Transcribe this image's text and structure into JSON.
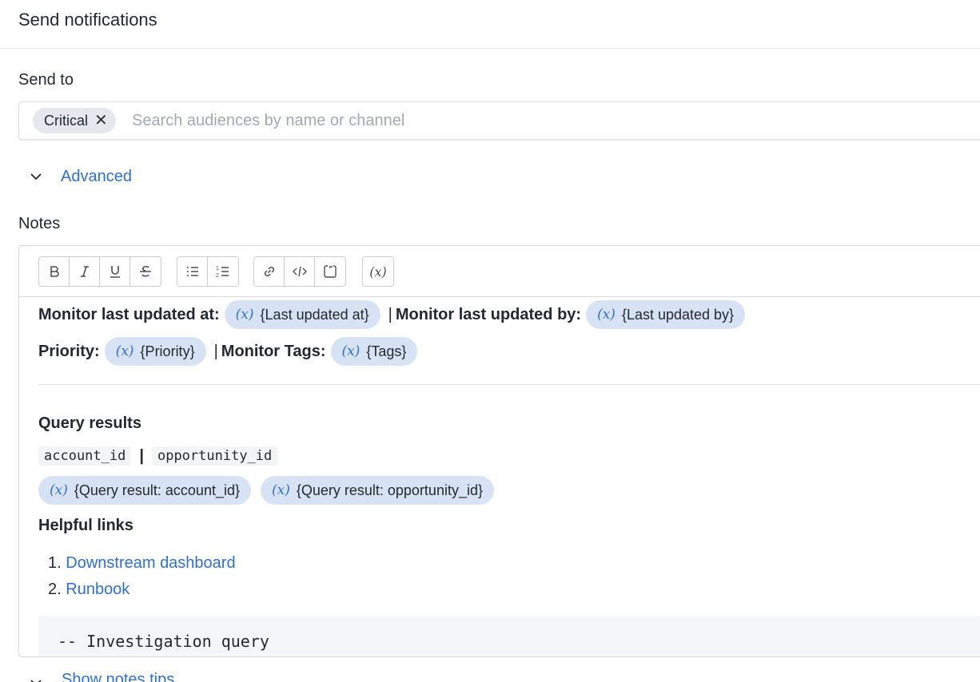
{
  "header": {
    "title": "Send notifications"
  },
  "send_to": {
    "label": "Send to",
    "chips": [
      {
        "label": "Critical",
        "remove_icon": "close-icon"
      }
    ],
    "search_placeholder": "Search audiences by name or channel"
  },
  "advanced": {
    "label": "Advanced",
    "icon": "chevron-down-icon"
  },
  "notes": {
    "label": "Notes",
    "toolbar": {
      "groups": [
        [
          "bold-icon",
          "italic-icon",
          "underline-icon",
          "strikethrough-icon"
        ],
        [
          "bullet-list-icon",
          "numbered-list-icon"
        ],
        [
          "link-icon",
          "code-icon",
          "code-block-icon"
        ],
        [
          "variable-icon"
        ]
      ],
      "variable_symbol": "(x)"
    },
    "content": {
      "line1": {
        "label_a": "Monitor last updated at:",
        "var_a": "{Last updated at}",
        "separator": "|",
        "label_b": "Monitor last updated by:",
        "var_b": "{Last updated by}"
      },
      "line2": {
        "label_a": "Priority:",
        "var_a": "{Priority}",
        "separator": "|",
        "label_b": "Monitor Tags:",
        "var_b": "{Tags}"
      },
      "query_results": {
        "heading": "Query results",
        "columns": [
          "account_id",
          "opportunity_id"
        ],
        "separator": "|",
        "vars": [
          "{Query result: account_id}",
          "{Query result: opportunity_id}"
        ]
      },
      "helpful_links": {
        "heading": "Helpful links",
        "items": [
          {
            "num": "1.",
            "label": "Downstream dashboard"
          },
          {
            "num": "2.",
            "label": "Runbook"
          }
        ]
      },
      "code_block": {
        "text": "-- Investigation query"
      }
    }
  },
  "footer": {
    "link": "Show notes tips"
  },
  "colors": {
    "link": "#2f6fce",
    "pill_bg": "#d7e3f4",
    "chip_bg": "#e4e7eb"
  }
}
